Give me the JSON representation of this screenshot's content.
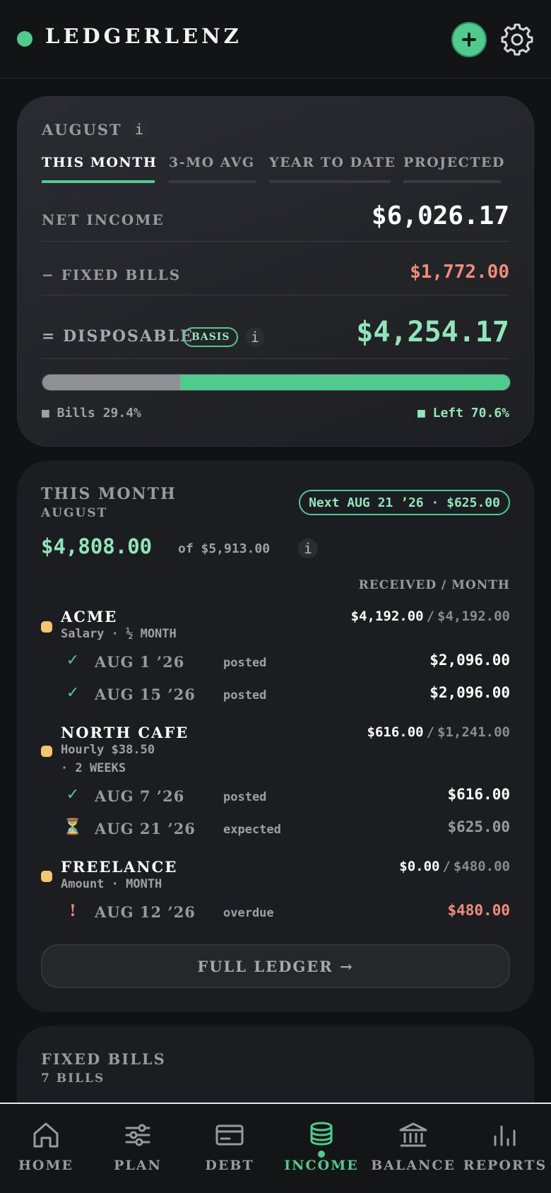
{
  "app": {
    "name": "LEDGERLENZ"
  },
  "summary": {
    "month": "AUGUST",
    "tabs": [
      "THIS MONTH",
      "3-MO AVG",
      "YEAR TO DATE",
      "PROJECTED"
    ],
    "active_tab": "THIS MONTH",
    "net_income_label": "NET INCOME",
    "net_income_value": "$6,026.17",
    "fixed_bills_label": "− FIXED BILLS",
    "fixed_bills_value": "$1,772.00",
    "disposable_label": "= DISPOSABLE",
    "basis_badge": "BASIS",
    "disposable_value": "$4,254.17",
    "bills_fraction": 0.294,
    "left_fraction": 0.706,
    "bills_legend": "■ Bills 29.4%",
    "left_legend": "■ Left 70.6%"
  },
  "income": {
    "title": "THIS MONTH",
    "month": "AUGUST",
    "next_pill": "Next AUG 21 ’26 · $625.00",
    "received": "$4,808.00",
    "of_text": "of $5,913.00",
    "column_header": "RECEIVED / MONTH",
    "sources": [
      {
        "name": "ACME",
        "sub1": "Salary · ½ MONTH",
        "sub2": "",
        "received": "$4,192.00",
        "sep": "/",
        "total": "$4,192.00",
        "payments": [
          {
            "icon": "✓",
            "date": "AUG 1 ’26",
            "status": "posted",
            "amount": "$2,096.00"
          },
          {
            "icon": "✓",
            "date": "AUG 15 ’26",
            "status": "posted",
            "amount": "$2,096.00"
          }
        ]
      },
      {
        "name": "NORTH CAFE",
        "sub1": "Hourly $38.50",
        "sub2": "· 2 WEEKS",
        "received": "$616.00",
        "sep": "/",
        "total": "$1,241.00",
        "payments": [
          {
            "icon": "✓",
            "date": "AUG 7 ’26",
            "status": "posted",
            "amount": "$616.00"
          },
          {
            "icon": "⏳",
            "date": "AUG 21 ’26",
            "status": "expected",
            "amount": "$625.00"
          }
        ]
      },
      {
        "name": "FREELANCE",
        "sub1": "Amount · MONTH",
        "sub2": "",
        "received": "$0.00",
        "sep": "/",
        "total": "$480.00",
        "payments": [
          {
            "icon": "!",
            "date": "AUG 12 ’26",
            "status": "overdue",
            "amount": "$480.00"
          }
        ]
      }
    ],
    "full_ledger_button": "FULL LEDGER →"
  },
  "fixed_bills": {
    "title": "FIXED BILLS",
    "count": "7 BILLS"
  },
  "nav": {
    "items": [
      "HOME",
      "PLAN",
      "DEBT",
      "INCOME",
      "BALANCE",
      "REPORTS"
    ],
    "active": "INCOME"
  },
  "colors": {
    "accent": "#4ecb8d",
    "negative": "#f08c7a",
    "pending_dot": "#f2c66d"
  }
}
